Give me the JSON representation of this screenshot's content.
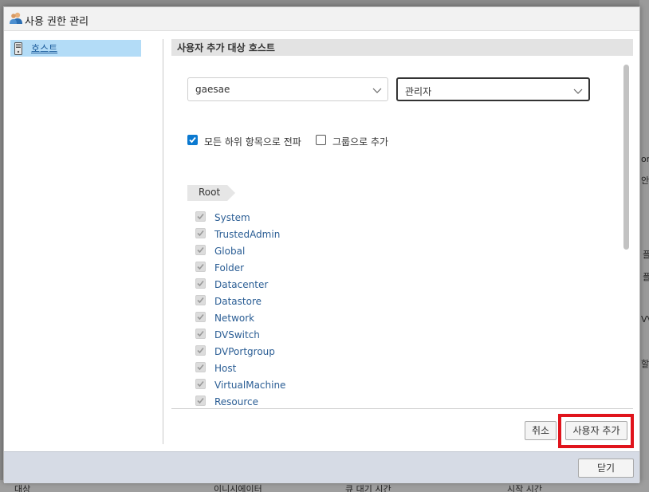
{
  "background": {
    "right_fragments": [
      "or",
      "안",
      "플",
      "플",
      "VV",
      "할"
    ],
    "bottom_bar": [
      "대상",
      "이니시에이터",
      "큐 대기 시간",
      "시작 시간"
    ]
  },
  "dialog": {
    "title": "사용 권한 관리",
    "title_icon": "users-icon",
    "nav": {
      "items": [
        {
          "label": "호스트",
          "icon": "host-icon"
        }
      ]
    },
    "section_title": "사용자 추가 대상 호스트",
    "user_select": {
      "value": "gaesae"
    },
    "role_select": {
      "value": "관리자"
    },
    "propagate": {
      "label": "모든 하위 항목으로 전파",
      "checked": true
    },
    "add_as_group": {
      "label": "그룹으로 추가",
      "checked": false
    },
    "root_label": "Root",
    "privileges": [
      "System",
      "TrustedAdmin",
      "Global",
      "Folder",
      "Datacenter",
      "Datastore",
      "Network",
      "DVSwitch",
      "DVPortgroup",
      "Host",
      "VirtualMachine",
      "Resource"
    ],
    "buttons": {
      "cancel": "취소",
      "add_user": "사용자 추가",
      "close": "닫기"
    },
    "colors": {
      "accent": "#0b79d0",
      "highlight": "#e0141c",
      "nav_selected": "#b3dcf7"
    }
  }
}
